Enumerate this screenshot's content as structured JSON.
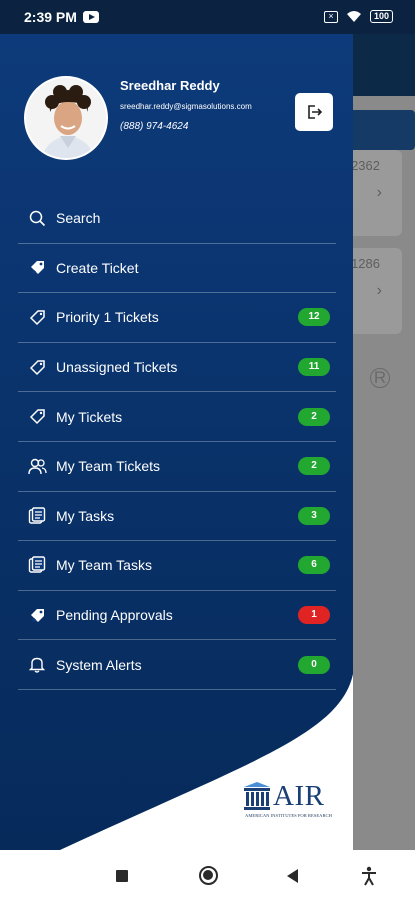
{
  "status_bar": {
    "time": "2:39 PM",
    "battery": "100"
  },
  "background": {
    "cards": [
      {
        "number": "2362"
      },
      {
        "number": "1286"
      }
    ]
  },
  "user": {
    "name": "Sreedhar Reddy",
    "email": "sreedhar.reddy@sigmasolutions.com",
    "phone": "(888) 974-4624"
  },
  "menu": [
    {
      "label": "Search",
      "icon": "search-icon"
    },
    {
      "label": "Create Ticket",
      "icon": "ticket-plus-icon"
    },
    {
      "label": "Priority 1 Tickets",
      "icon": "tag-icon",
      "count": "12",
      "badge_color": "#22a831"
    },
    {
      "label": "Unassigned Tickets",
      "icon": "tag-icon",
      "count": "11",
      "badge_color": "#22a831"
    },
    {
      "label": "My Tickets",
      "icon": "tag-icon",
      "count": "2",
      "badge_color": "#22a831"
    },
    {
      "label": "My Team Tickets",
      "icon": "team-icon",
      "count": "2",
      "badge_color": "#22a831"
    },
    {
      "label": "My Tasks",
      "icon": "tasks-icon",
      "count": "3",
      "badge_color": "#22a831"
    },
    {
      "label": "My Team Tasks",
      "icon": "tasks-icon",
      "count": "6",
      "badge_color": "#22a831"
    },
    {
      "label": "Pending Approvals",
      "icon": "ticket-plus-icon",
      "count": "1",
      "badge_color": "#e02424"
    },
    {
      "label": "System Alerts",
      "icon": "bell-icon",
      "count": "0",
      "badge_color": "#22a831"
    }
  ],
  "logo": {
    "text": "AIR",
    "tagline": "AMERICAN INSTITUTES FOR RESEARCH"
  },
  "colors": {
    "drawer_top": "#0d3a7a",
    "drawer_bottom": "#062a5a",
    "badge_green": "#22a831",
    "badge_red": "#e02424"
  }
}
